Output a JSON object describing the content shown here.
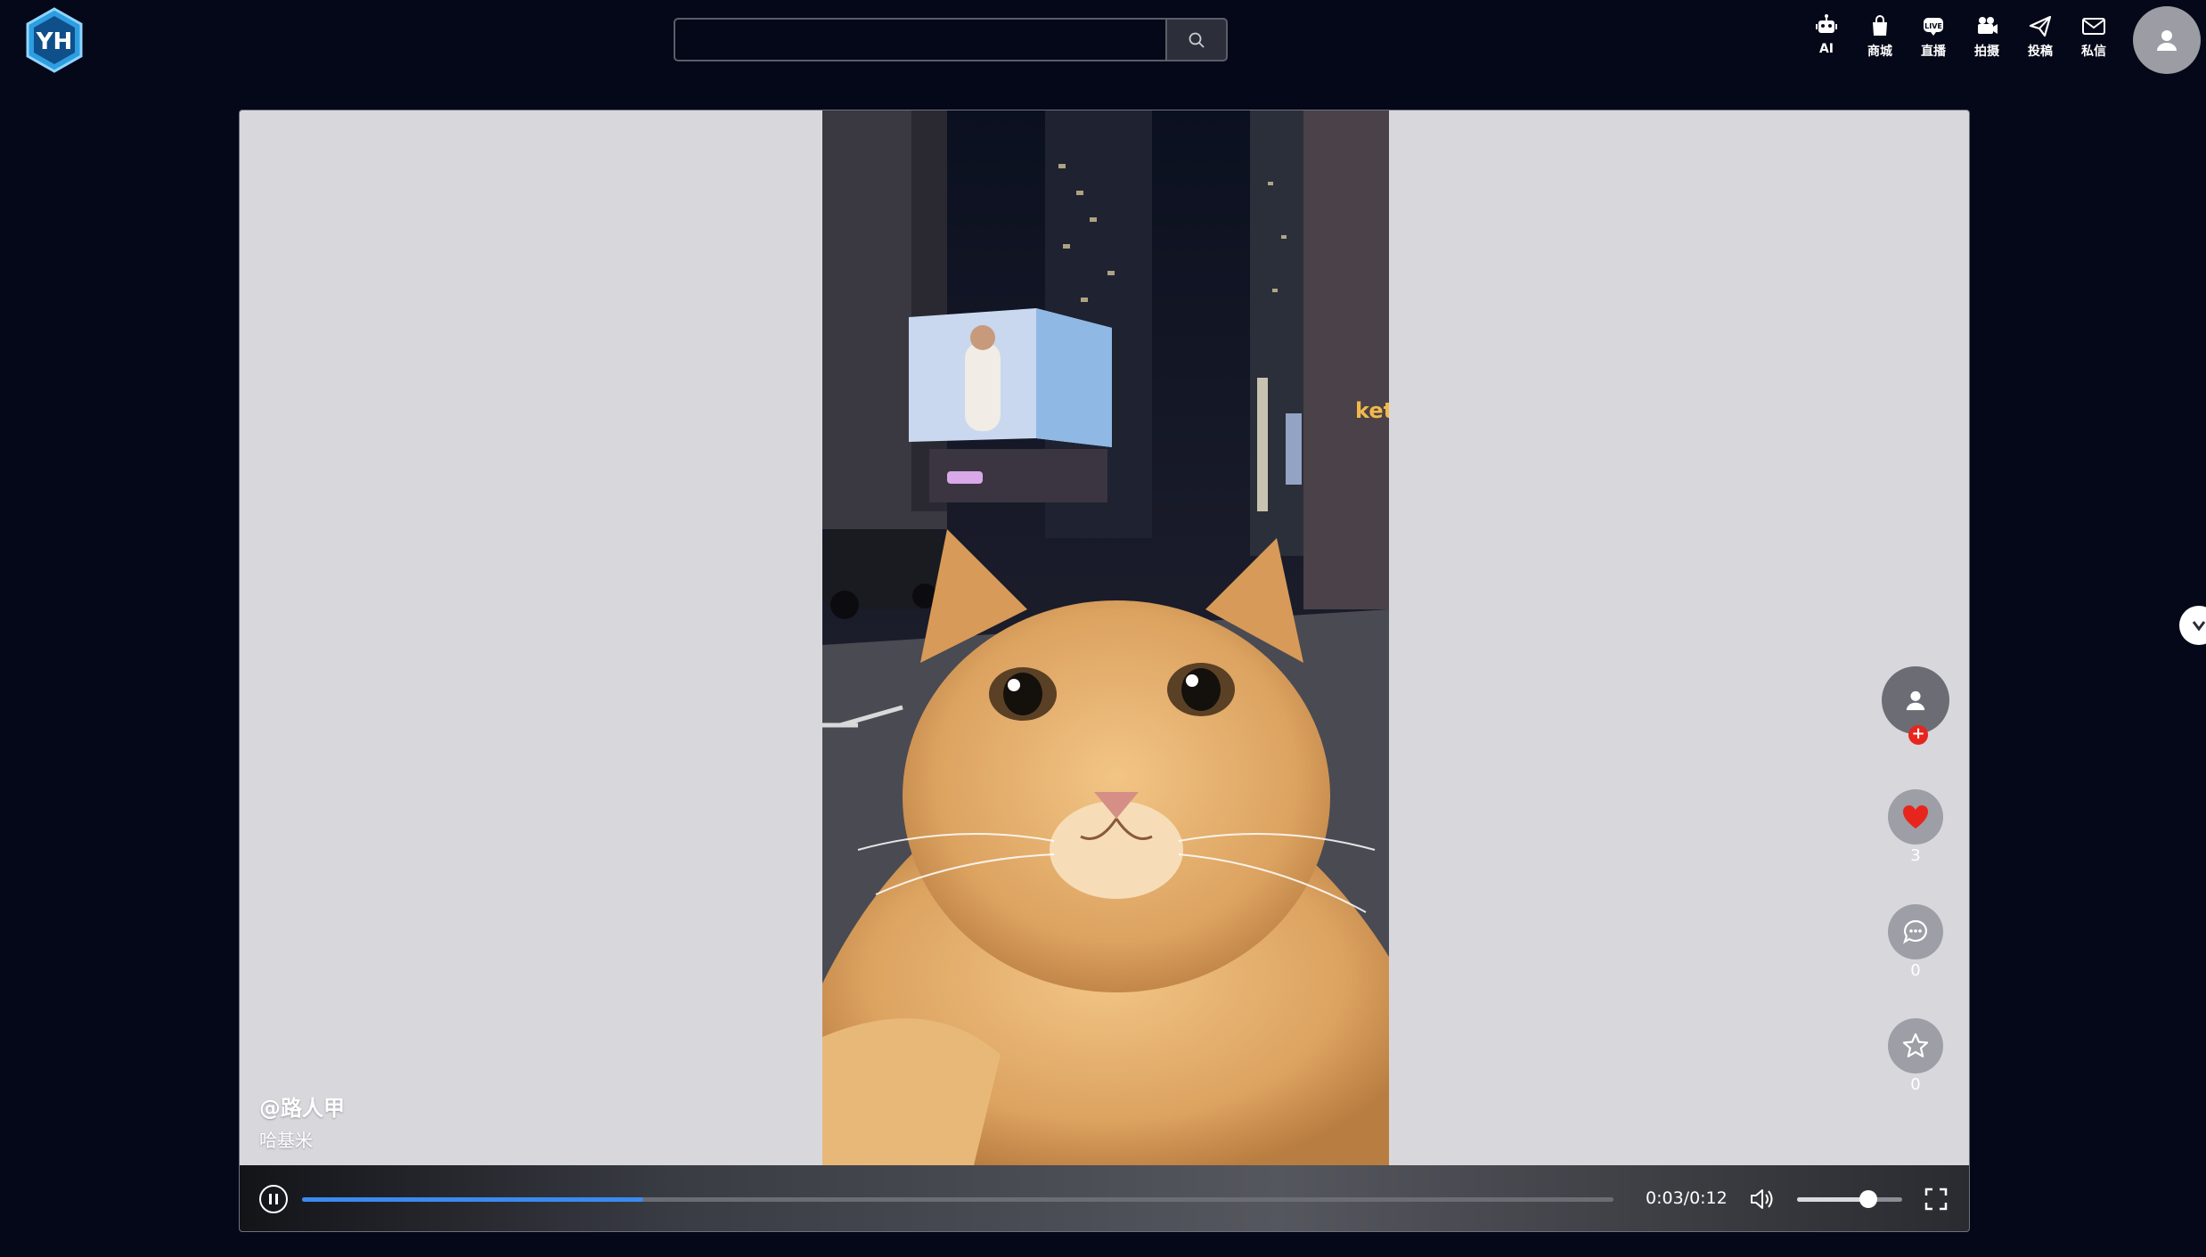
{
  "header": {
    "logo_text": "YH",
    "search": {
      "value": "",
      "placeholder": ""
    },
    "nav": [
      {
        "label": "AI",
        "icon": "robot-icon"
      },
      {
        "label": "商城",
        "icon": "shopping-bag-icon"
      },
      {
        "label": "直播",
        "icon": "live-icon"
      },
      {
        "label": "拍摄",
        "icon": "video-camera-icon"
      },
      {
        "label": "投稿",
        "icon": "send-icon"
      },
      {
        "label": "私信",
        "icon": "mail-icon"
      }
    ]
  },
  "video": {
    "author": "@路人甲",
    "description": "哈基米",
    "likes": "3",
    "comments": "0",
    "favorites": "0",
    "time": "0:03/0:12",
    "progress": 0.26,
    "volume": 0.68
  },
  "colors": {
    "background": "#050818",
    "player_bg": "#d8d7dc",
    "progress": "#3a8bf0",
    "like": "#e8251d"
  }
}
